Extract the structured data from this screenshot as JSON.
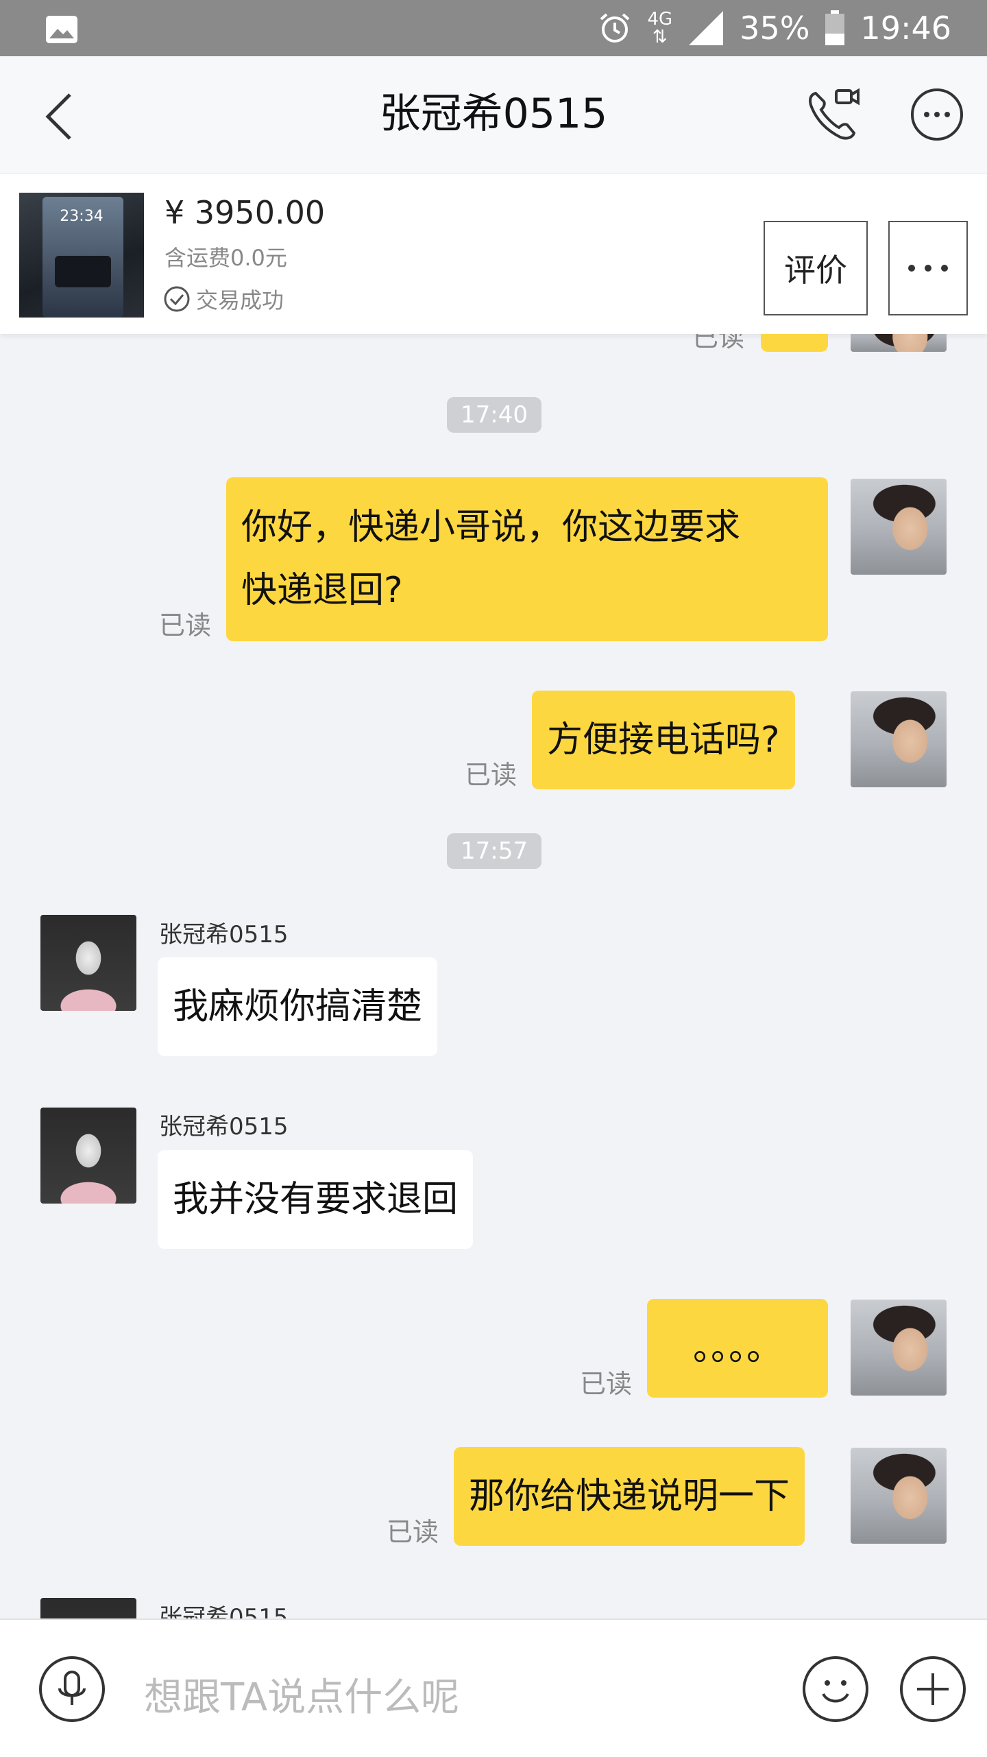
{
  "status_bar": {
    "network": "4G",
    "battery": "35%",
    "time": "19:46"
  },
  "header": {
    "title": "张冠希0515"
  },
  "product": {
    "thumb_time": "23:34",
    "price": "¥ 3950.00",
    "shipping": "含运费0.0元",
    "status": "交易成功",
    "review_label": "评价"
  },
  "chat": {
    "partial_top_read": "已读",
    "time_1": "17:40",
    "msg_1": "你好，快递小哥说，你这边要求快递退回?",
    "msg_1_line1": "你好，快递小哥说，你这边要求",
    "msg_1_line2": "快递退回?",
    "msg_1_read": "已读",
    "msg_2": "方便接电话吗?",
    "msg_2_read": "已读",
    "time_2": "17:57",
    "sender_name": "张冠希0515",
    "msg_3": "我麻烦你搞清楚",
    "msg_4": "我并没有要求退回",
    "msg_5": "。。。。",
    "msg_5_read": "已读",
    "msg_6": "那你给快递说明一下",
    "msg_6_read": "已读"
  },
  "input": {
    "placeholder": "想跟TA说点什么呢"
  },
  "colors": {
    "my_bubble": "#fdd73f",
    "background": "#f2f3f7"
  }
}
